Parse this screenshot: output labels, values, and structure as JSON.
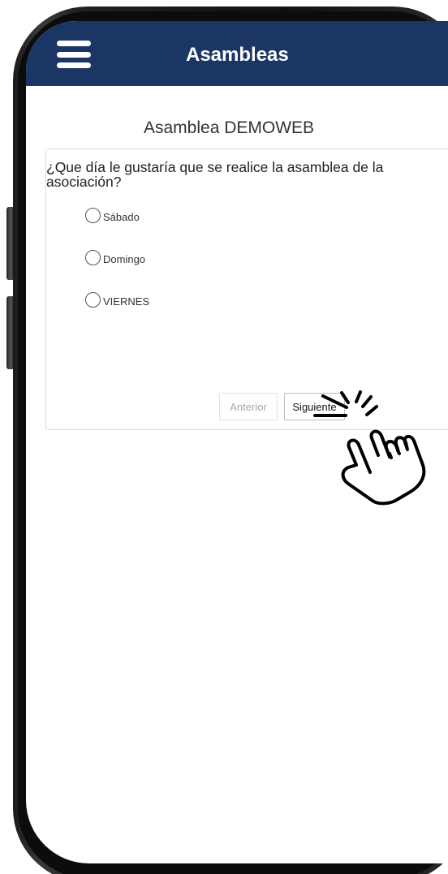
{
  "header": {
    "title": "Asambleas",
    "menu_icon": "hamburger-menu-icon",
    "background_color": "#1b3564"
  },
  "main": {
    "page_title": "Asamblea DEMOWEB",
    "question": "¿Que día le gustaría que se realice la asamblea de la asociación?",
    "options": [
      {
        "label": "Sábado",
        "selected": false
      },
      {
        "label": "Domingo",
        "selected": false
      },
      {
        "label": "VIERNES",
        "selected": false
      }
    ],
    "buttons": {
      "previous_label": "Anterior",
      "previous_enabled": false,
      "next_label": "Siguiente"
    }
  },
  "overlay": {
    "pointer_icon": "tapping-hand-icon"
  }
}
